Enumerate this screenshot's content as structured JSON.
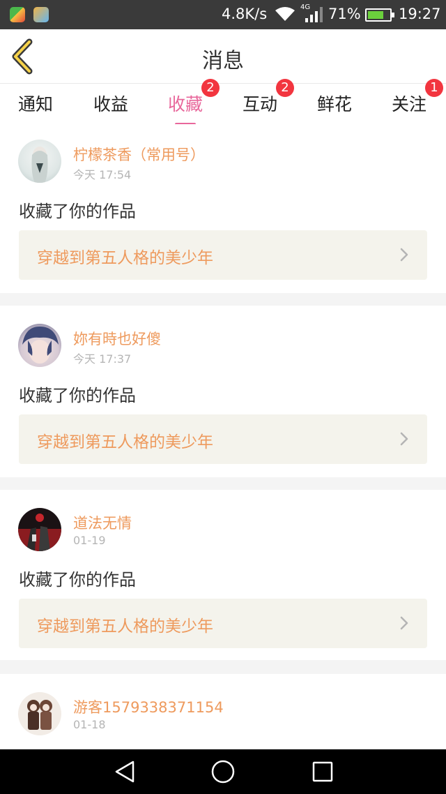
{
  "status_bar": {
    "net_speed": "4.8K/s",
    "network_type": "4G",
    "battery_pct": "71%",
    "time": "19:27",
    "icons": [
      "app-icon-1",
      "app-icon-2",
      "wifi-icon",
      "signal-icon",
      "battery-icon"
    ]
  },
  "header": {
    "back_icon": "chevron-left-icon",
    "title": "消息"
  },
  "tabs": [
    {
      "label": "通知",
      "badge": ""
    },
    {
      "label": "收益",
      "badge": ""
    },
    {
      "label": "收藏",
      "badge": "2",
      "active": true
    },
    {
      "label": "互动",
      "badge": "2"
    },
    {
      "label": "鲜花",
      "badge": ""
    },
    {
      "label": "关注",
      "badge": "1"
    }
  ],
  "messages": [
    {
      "username": "柠檬茶香（常用号）",
      "time": "今天 17:54",
      "action": "收藏了你的作品",
      "work_title": "穿越到第五人格的美少年"
    },
    {
      "username": "妳有時也好傻",
      "time": "今天 17:37",
      "action": "收藏了你的作品",
      "work_title": "穿越到第五人格的美少年"
    },
    {
      "username": "道法无情",
      "time": "01-19",
      "action": "收藏了你的作品",
      "work_title": "穿越到第五人格的美少年"
    },
    {
      "username": "游客1579338371154",
      "time": "01-18",
      "action": "",
      "work_title": ""
    }
  ],
  "colors": {
    "accent_pink": "#e8679b",
    "username_orange": "#ee9a5d",
    "badge_red": "#f2353f",
    "work_box_bg": "#f4f3ec"
  },
  "nav_bar": {
    "icons": [
      "back-triangle-icon",
      "home-circle-icon",
      "recents-square-icon"
    ]
  }
}
